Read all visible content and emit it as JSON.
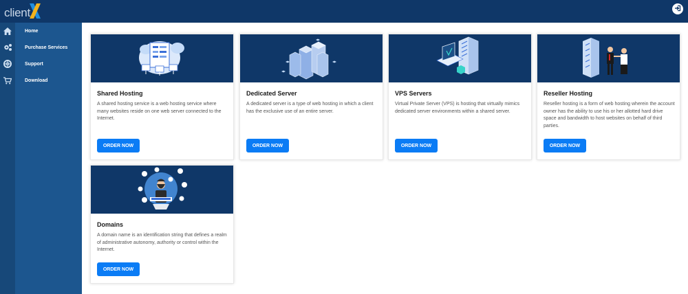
{
  "brand": {
    "name_left": "client",
    "name_x": "X"
  },
  "colors": {
    "topbar": "#0f3768",
    "sidebar": "#1c568f",
    "rail": "#174879",
    "accent": "#0b7cf5"
  },
  "header": {
    "logout_icon": "sign-out-icon"
  },
  "sidebar": {
    "items": [
      {
        "label": "Home",
        "icon": "home-icon"
      },
      {
        "label": "Purchase Services",
        "icon": "gears-icon"
      },
      {
        "label": "Support",
        "icon": "life-ring-icon"
      },
      {
        "label": "Download",
        "icon": "cart-icon"
      }
    ]
  },
  "products": [
    {
      "title": "Shared Hosting",
      "description": "A shared hosting service is a web hosting service where many websites reside on one web server connected to the Internet.",
      "button": "ORDER NOW"
    },
    {
      "title": "Dedicated Server",
      "description": "A dedicated server is a type of web hosting in which a client has the exclusive use of an entire server.",
      "button": "ORDER NOW"
    },
    {
      "title": "VPS Servers",
      "description": "Virtual Private Server (VPS) is hosting that virtually mimics dedicated server environments within a shared server.",
      "button": "ORDER NOW"
    },
    {
      "title": "Reseller Hosting",
      "description": "Reseller hosting is a form of web hosting wherein the account owner has the ability to use his or her allotted hard drive space and bandwidth to host websites on behalf of third parties.",
      "button": "ORDER NOW"
    },
    {
      "title": "Domains",
      "description": "A domain name is an identification string that defines a realm of administrative autonomy, authority or control within the Internet.",
      "button": "ORDER NOW"
    }
  ]
}
